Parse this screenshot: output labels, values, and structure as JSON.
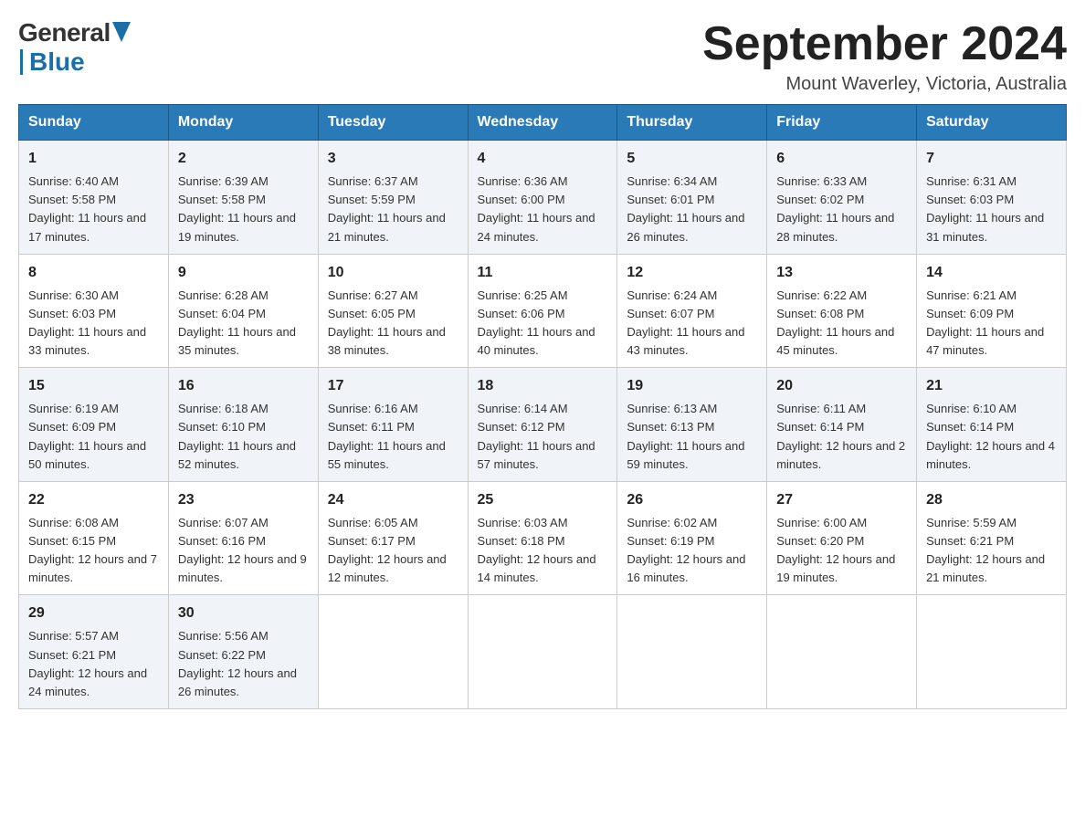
{
  "header": {
    "logo_general": "General",
    "logo_blue": "Blue",
    "month_year": "September 2024",
    "location": "Mount Waverley, Victoria, Australia"
  },
  "days_of_week": [
    "Sunday",
    "Monday",
    "Tuesday",
    "Wednesday",
    "Thursday",
    "Friday",
    "Saturday"
  ],
  "weeks": [
    [
      {
        "day": "1",
        "sunrise": "6:40 AM",
        "sunset": "5:58 PM",
        "daylight": "11 hours and 17 minutes."
      },
      {
        "day": "2",
        "sunrise": "6:39 AM",
        "sunset": "5:58 PM",
        "daylight": "11 hours and 19 minutes."
      },
      {
        "day": "3",
        "sunrise": "6:37 AM",
        "sunset": "5:59 PM",
        "daylight": "11 hours and 21 minutes."
      },
      {
        "day": "4",
        "sunrise": "6:36 AM",
        "sunset": "6:00 PM",
        "daylight": "11 hours and 24 minutes."
      },
      {
        "day": "5",
        "sunrise": "6:34 AM",
        "sunset": "6:01 PM",
        "daylight": "11 hours and 26 minutes."
      },
      {
        "day": "6",
        "sunrise": "6:33 AM",
        "sunset": "6:02 PM",
        "daylight": "11 hours and 28 minutes."
      },
      {
        "day": "7",
        "sunrise": "6:31 AM",
        "sunset": "6:03 PM",
        "daylight": "11 hours and 31 minutes."
      }
    ],
    [
      {
        "day": "8",
        "sunrise": "6:30 AM",
        "sunset": "6:03 PM",
        "daylight": "11 hours and 33 minutes."
      },
      {
        "day": "9",
        "sunrise": "6:28 AM",
        "sunset": "6:04 PM",
        "daylight": "11 hours and 35 minutes."
      },
      {
        "day": "10",
        "sunrise": "6:27 AM",
        "sunset": "6:05 PM",
        "daylight": "11 hours and 38 minutes."
      },
      {
        "day": "11",
        "sunrise": "6:25 AM",
        "sunset": "6:06 PM",
        "daylight": "11 hours and 40 minutes."
      },
      {
        "day": "12",
        "sunrise": "6:24 AM",
        "sunset": "6:07 PM",
        "daylight": "11 hours and 43 minutes."
      },
      {
        "day": "13",
        "sunrise": "6:22 AM",
        "sunset": "6:08 PM",
        "daylight": "11 hours and 45 minutes."
      },
      {
        "day": "14",
        "sunrise": "6:21 AM",
        "sunset": "6:09 PM",
        "daylight": "11 hours and 47 minutes."
      }
    ],
    [
      {
        "day": "15",
        "sunrise": "6:19 AM",
        "sunset": "6:09 PM",
        "daylight": "11 hours and 50 minutes."
      },
      {
        "day": "16",
        "sunrise": "6:18 AM",
        "sunset": "6:10 PM",
        "daylight": "11 hours and 52 minutes."
      },
      {
        "day": "17",
        "sunrise": "6:16 AM",
        "sunset": "6:11 PM",
        "daylight": "11 hours and 55 minutes."
      },
      {
        "day": "18",
        "sunrise": "6:14 AM",
        "sunset": "6:12 PM",
        "daylight": "11 hours and 57 minutes."
      },
      {
        "day": "19",
        "sunrise": "6:13 AM",
        "sunset": "6:13 PM",
        "daylight": "11 hours and 59 minutes."
      },
      {
        "day": "20",
        "sunrise": "6:11 AM",
        "sunset": "6:14 PM",
        "daylight": "12 hours and 2 minutes."
      },
      {
        "day": "21",
        "sunrise": "6:10 AM",
        "sunset": "6:14 PM",
        "daylight": "12 hours and 4 minutes."
      }
    ],
    [
      {
        "day": "22",
        "sunrise": "6:08 AM",
        "sunset": "6:15 PM",
        "daylight": "12 hours and 7 minutes."
      },
      {
        "day": "23",
        "sunrise": "6:07 AM",
        "sunset": "6:16 PM",
        "daylight": "12 hours and 9 minutes."
      },
      {
        "day": "24",
        "sunrise": "6:05 AM",
        "sunset": "6:17 PM",
        "daylight": "12 hours and 12 minutes."
      },
      {
        "day": "25",
        "sunrise": "6:03 AM",
        "sunset": "6:18 PM",
        "daylight": "12 hours and 14 minutes."
      },
      {
        "day": "26",
        "sunrise": "6:02 AM",
        "sunset": "6:19 PM",
        "daylight": "12 hours and 16 minutes."
      },
      {
        "day": "27",
        "sunrise": "6:00 AM",
        "sunset": "6:20 PM",
        "daylight": "12 hours and 19 minutes."
      },
      {
        "day": "28",
        "sunrise": "5:59 AM",
        "sunset": "6:21 PM",
        "daylight": "12 hours and 21 minutes."
      }
    ],
    [
      {
        "day": "29",
        "sunrise": "5:57 AM",
        "sunset": "6:21 PM",
        "daylight": "12 hours and 24 minutes."
      },
      {
        "day": "30",
        "sunrise": "5:56 AM",
        "sunset": "6:22 PM",
        "daylight": "12 hours and 26 minutes."
      },
      null,
      null,
      null,
      null,
      null
    ]
  ]
}
